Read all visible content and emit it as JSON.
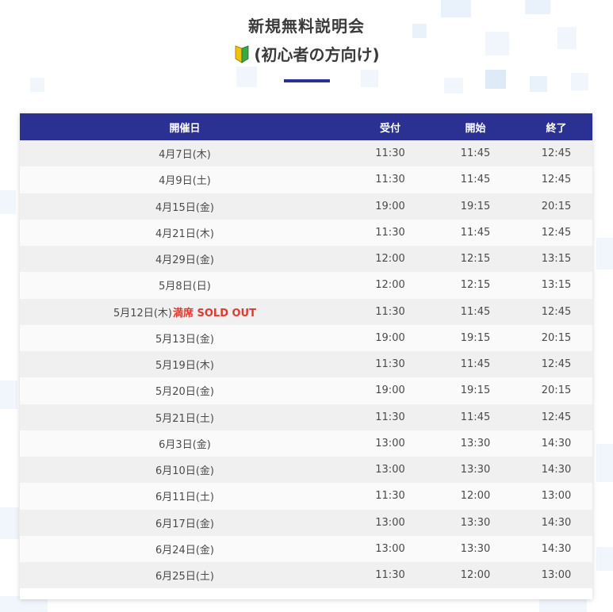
{
  "header": {
    "title": "新規無料説明会",
    "subtitle": "(初心者の方向け)",
    "subtitle_icon": "beginner-mark-icon",
    "accent_color": "#2b3192"
  },
  "table": {
    "columns": {
      "date": "開催日",
      "reception": "受付",
      "start": "開始",
      "end": "終了"
    },
    "rows": [
      {
        "date": "4月7日(木)",
        "status": "",
        "reception": "11:30",
        "start": "11:45",
        "end": "12:45"
      },
      {
        "date": "4月9日(土)",
        "status": "",
        "reception": "11:30",
        "start": "11:45",
        "end": "12:45"
      },
      {
        "date": "4月15日(金)",
        "status": "",
        "reception": "19:00",
        "start": "19:15",
        "end": "20:15"
      },
      {
        "date": "4月21日(木)",
        "status": "",
        "reception": "11:30",
        "start": "11:45",
        "end": "12:45"
      },
      {
        "date": "4月29日(金)",
        "status": "",
        "reception": "12:00",
        "start": "12:15",
        "end": "13:15"
      },
      {
        "date": "5月8日(日)",
        "status": "",
        "reception": "12:00",
        "start": "12:15",
        "end": "13:15"
      },
      {
        "date": "5月12日(木)",
        "status": "満席 SOLD OUT",
        "reception": "11:30",
        "start": "11:45",
        "end": "12:45"
      },
      {
        "date": "5月13日(金)",
        "status": "",
        "reception": "19:00",
        "start": "19:15",
        "end": "20:15"
      },
      {
        "date": "5月19日(木)",
        "status": "",
        "reception": "11:30",
        "start": "11:45",
        "end": "12:45"
      },
      {
        "date": "5月20日(金)",
        "status": "",
        "reception": "19:00",
        "start": "19:15",
        "end": "20:15"
      },
      {
        "date": "5月21日(土)",
        "status": "",
        "reception": "11:30",
        "start": "11:45",
        "end": "12:45"
      },
      {
        "date": "6月3日(金)",
        "status": "",
        "reception": "13:00",
        "start": "13:30",
        "end": "14:30"
      },
      {
        "date": "6月10日(金)",
        "status": "",
        "reception": "13:00",
        "start": "13:30",
        "end": "14:30"
      },
      {
        "date": "6月11日(土)",
        "status": "",
        "reception": "11:30",
        "start": "12:00",
        "end": "13:00"
      },
      {
        "date": "6月17日(金)",
        "status": "",
        "reception": "13:00",
        "start": "13:30",
        "end": "14:30"
      },
      {
        "date": "6月24日(金)",
        "status": "",
        "reception": "13:00",
        "start": "13:30",
        "end": "14:30"
      },
      {
        "date": "6月25日(土)",
        "status": "",
        "reception": "11:30",
        "start": "12:00",
        "end": "13:00"
      }
    ],
    "soldout_color": "#e03a2f"
  }
}
